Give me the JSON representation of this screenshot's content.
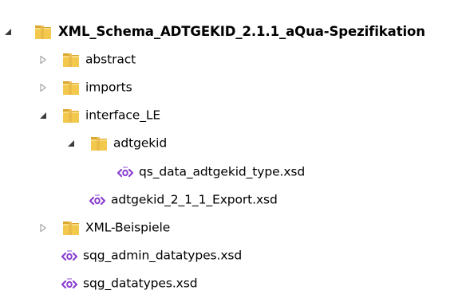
{
  "tree": {
    "root": {
      "label": "XML_Schema_ADTGEKID_2.1.1_aQua-Spezifikation",
      "expander": "expanded",
      "icon": "folder-icon"
    },
    "items": [
      {
        "label": "abstract",
        "expander": "collapsed",
        "icon": "folder-icon"
      },
      {
        "label": "imports",
        "expander": "collapsed",
        "icon": "folder-icon"
      },
      {
        "label": "interface_LE",
        "expander": "expanded",
        "icon": "folder-icon"
      },
      {
        "label": "adtgekid",
        "expander": "expanded",
        "icon": "folder-icon"
      },
      {
        "label": "qs_data_adtgekid_type.xsd",
        "expander": "none",
        "icon": "xsd-file-icon"
      },
      {
        "label": "adtgekid_2_1_1_Export.xsd",
        "expander": "none",
        "icon": "xsd-file-icon"
      },
      {
        "label": "XML-Beispiele",
        "expander": "collapsed",
        "icon": "folder-icon"
      },
      {
        "label": "sqg_admin_datatypes.xsd",
        "expander": "none",
        "icon": "xsd-file-icon"
      },
      {
        "label": "sqg_datatypes.xsd",
        "expander": "none",
        "icon": "xsd-file-icon"
      }
    ]
  },
  "colors": {
    "folder_front": "#f2c94c",
    "folder_back": "#d9a62e",
    "xsd_icon": "#8a3fd1",
    "expander_expanded": "#3c3c3c",
    "expander_collapsed": "#a6a6a6"
  }
}
